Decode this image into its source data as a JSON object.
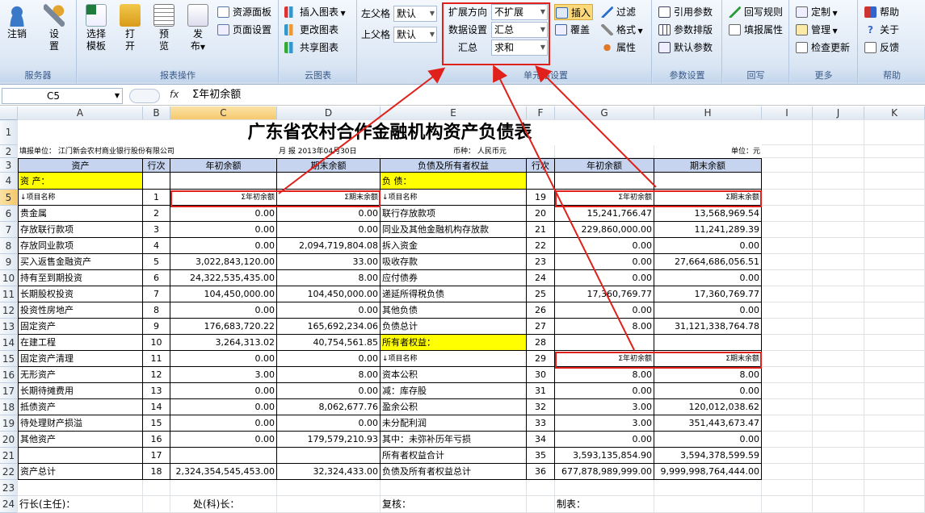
{
  "ribbon": {
    "groups": {
      "server": {
        "title": "服务器",
        "login": "注销",
        "settings": "设\n置"
      },
      "report": {
        "title": "报表操作",
        "select_template": "选择\n模板",
        "open": "打\n开",
        "preview": "预\n览",
        "publish": "发\n布",
        "resource_panel": "资源面板",
        "page_setup": "页面设置"
      },
      "cloud": {
        "title": "云图表",
        "insert_chart": "插入图表",
        "edit_chart": "更改图表",
        "share_chart": "共享图表"
      },
      "parent": {
        "left_label": "左父格",
        "left_value": "默认",
        "top_label": "上父格",
        "top_value": "默认"
      },
      "cell": {
        "title": "单元格设置",
        "expand_label": "扩展方向",
        "expand_value": "不扩展",
        "dataset_label": "数据设置",
        "dataset_value": "汇总",
        "summary_label": "汇总",
        "summary_value": "求和",
        "insert": "插入",
        "cover": "覆盖",
        "filter": "过滤",
        "format": "格式",
        "property": "属性"
      },
      "param": {
        "title": "参数设置",
        "ref_param": "引用参数",
        "param_layout": "参数排版",
        "default_param": "默认参数"
      },
      "writeback": {
        "title": "回写",
        "rule": "回写规则",
        "fill_property": "填报属性"
      },
      "more": {
        "title": "更多",
        "custom": "定制",
        "manage": "管理",
        "check_update": "检查更新"
      },
      "help": {
        "title": "帮助",
        "help": "帮助",
        "about": "关于",
        "feedback": "反馈"
      }
    }
  },
  "formula_bar": {
    "cell_ref": "C5",
    "fx": "fx",
    "content": "Σ年初余额"
  },
  "columns": [
    "A",
    "B",
    "C",
    "D",
    "E",
    "F",
    "G",
    "H",
    "I",
    "J",
    "K"
  ],
  "rows": [
    "1",
    "2",
    "3",
    "4",
    "5",
    "6",
    "7",
    "8",
    "9",
    "10",
    "11",
    "12",
    "13",
    "14",
    "15",
    "16",
    "17",
    "18",
    "19",
    "20",
    "21",
    "22",
    "23",
    "24"
  ],
  "sheet": {
    "title": "广东省农村合作金融机构资产负债表",
    "row2": {
      "unit": "填报单位： 江门新会农村商业银行股份有限公司",
      "period": "月 报  2013年04月30日",
      "currency": "币种： 人民币元",
      "unit_right": "单位：元"
    },
    "header": {
      "a": "资产",
      "b": "行次",
      "c": "年初余额",
      "d": "期末余额",
      "e": "负债及所有者权益",
      "f": "行次",
      "g": "年初余额",
      "h": "期末余额"
    },
    "assets_label": "资 产：",
    "liab_label": "负 债：",
    "equity_label": "所有者权益：",
    "left_rows": [
      {
        "name": "↓项目名称",
        "no": "1",
        "begin": "Σ年初余额",
        "end": "Σ期末余额"
      },
      {
        "name": "贵金属",
        "no": "2",
        "begin": "0.00",
        "end": "0.00"
      },
      {
        "name": "存放联行款项",
        "no": "3",
        "begin": "0.00",
        "end": "0.00"
      },
      {
        "name": "存放同业款项",
        "no": "4",
        "begin": "0.00",
        "end": "2,094,719,804.08"
      },
      {
        "name": "买入返售金融资产",
        "no": "5",
        "begin": "3,022,843,120.00",
        "end": "33.00"
      },
      {
        "name": "持有至到期投资",
        "no": "6",
        "begin": "24,322,535,435.00",
        "end": "8.00"
      },
      {
        "name": "长期股权投资",
        "no": "7",
        "begin": "104,450,000.00",
        "end": "104,450,000.00"
      },
      {
        "name": "投资性房地产",
        "no": "8",
        "begin": "0.00",
        "end": "0.00"
      },
      {
        "name": "固定资产",
        "no": "9",
        "begin": "176,683,720.22",
        "end": "165,692,234.06"
      },
      {
        "name": "在建工程",
        "no": "10",
        "begin": "3,264,313.02",
        "end": "40,754,561.85"
      },
      {
        "name": "固定资产清理",
        "no": "11",
        "begin": "0.00",
        "end": "0.00"
      },
      {
        "name": "无形资产",
        "no": "12",
        "begin": "3.00",
        "end": "8.00"
      },
      {
        "name": "长期待摊费用",
        "no": "13",
        "begin": "0.00",
        "end": "0.00"
      },
      {
        "name": "抵债资产",
        "no": "14",
        "begin": "0.00",
        "end": "8,062,677.76"
      },
      {
        "name": "待处理财产损溢",
        "no": "15",
        "begin": "0.00",
        "end": "0.00"
      },
      {
        "name": "其他资产",
        "no": "16",
        "begin": "0.00",
        "end": "179,579,210.93"
      },
      {
        "name": "",
        "no": "17",
        "begin": "",
        "end": ""
      },
      {
        "name": "资产总计",
        "no": "18",
        "begin": "2,324,354,545,453.00",
        "end": "32,324,433.00"
      }
    ],
    "right_rows": [
      {
        "name": "↓项目名称",
        "no": "19",
        "begin": "Σ年初余额",
        "end": "Σ期末余额"
      },
      {
        "name": "联行存放款项",
        "no": "20",
        "begin": "15,241,766.47",
        "end": "13,568,969.54"
      },
      {
        "name": "同业及其他金融机构存放款",
        "no": "21",
        "begin": "229,860,000.00",
        "end": "11,241,289.39"
      },
      {
        "name": "拆入资金",
        "no": "22",
        "begin": "0.00",
        "end": "0.00"
      },
      {
        "name": "吸收存款",
        "no": "23",
        "begin": "0.00",
        "end": "27,664,686,056.51"
      },
      {
        "name": "应付债券",
        "no": "24",
        "begin": "0.00",
        "end": "0.00"
      },
      {
        "name": "递延所得税负债",
        "no": "25",
        "begin": "17,360,769.77",
        "end": "17,360,769.77"
      },
      {
        "name": "其他负债",
        "no": "26",
        "begin": "0.00",
        "end": "0.00"
      },
      {
        "name": "负债总计",
        "no": "27",
        "begin": "8.00",
        "end": "31,121,338,764.78"
      },
      {
        "name": "所有者权益：",
        "no": "28",
        "begin": "",
        "end": ""
      },
      {
        "name": "↓项目名称",
        "no": "29",
        "begin": "Σ年初余额",
        "end": "Σ期末余额"
      },
      {
        "name": "资本公积",
        "no": "30",
        "begin": "8.00",
        "end": "8.00"
      },
      {
        "name": "减：库存股",
        "no": "31",
        "begin": "0.00",
        "end": "0.00"
      },
      {
        "name": "盈余公积",
        "no": "32",
        "begin": "3.00",
        "end": "120,012,038.62"
      },
      {
        "name": "未分配利润",
        "no": "33",
        "begin": "3.00",
        "end": "351,443,673.47"
      },
      {
        "name": "其中：未弥补历年亏损",
        "no": "34",
        "begin": "0.00",
        "end": "0.00"
      },
      {
        "name": "所有者权益合计",
        "no": "35",
        "begin": "3,593,135,854.90",
        "end": "3,594,378,599.59"
      },
      {
        "name": "负债及所有者权益总计",
        "no": "36",
        "begin": "677,878,989,999.00",
        "end": "9,999,998,764,444.00"
      }
    ],
    "footer": {
      "head": "行长(主任)：",
      "dept": "处(科)长：",
      "review": "复核：",
      "maker": "制表："
    }
  },
  "colors": {
    "accent": "#e0201a",
    "header_fill": "#c6d4f0",
    "highlight": "#ffff00"
  }
}
